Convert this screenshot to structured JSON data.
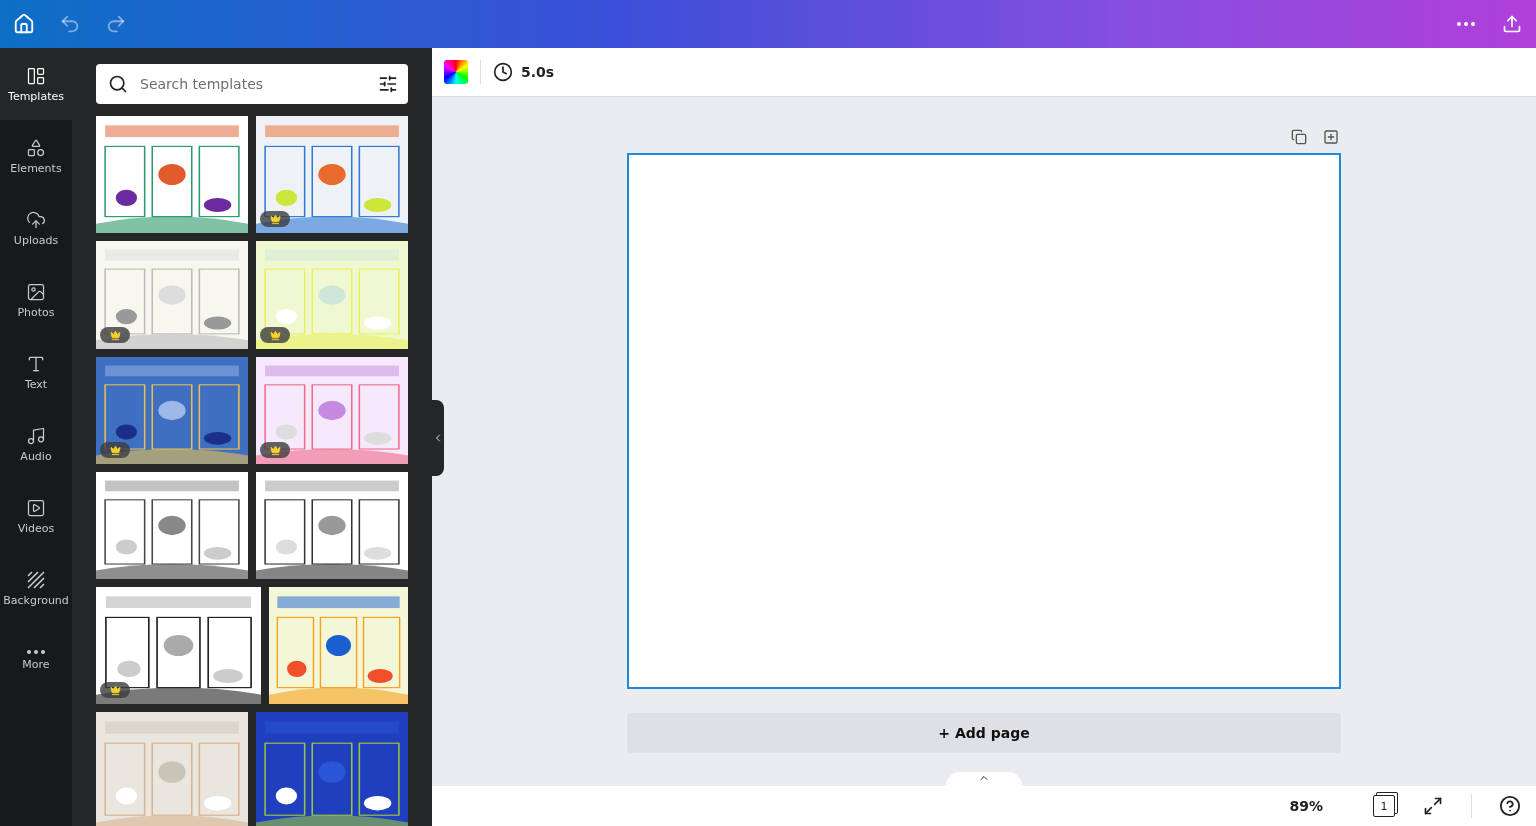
{
  "rail": [
    {
      "label": "Templates",
      "selected": true
    },
    {
      "label": "Elements",
      "selected": false
    },
    {
      "label": "Uploads",
      "selected": false
    },
    {
      "label": "Photos",
      "selected": false
    },
    {
      "label": "Text",
      "selected": false
    },
    {
      "label": "Audio",
      "selected": false
    },
    {
      "label": "Videos",
      "selected": false
    },
    {
      "label": "Background",
      "selected": false
    },
    {
      "label": "More",
      "selected": false
    }
  ],
  "search": {
    "placeholder": "Search templates"
  },
  "templates": [
    {
      "kind": "picture",
      "premium": false
    },
    {
      "kind": "picture",
      "premium": true
    },
    {
      "kind": "picture",
      "premium": true
    },
    {
      "kind": "picture",
      "premium": true
    },
    {
      "kind": "picture",
      "premium": true
    },
    {
      "kind": "picture",
      "premium": true
    },
    {
      "kind": "picture",
      "premium": false
    },
    {
      "kind": "picture",
      "premium": false
    },
    {
      "kind": "picture",
      "premium": true
    },
    {
      "kind": "picture",
      "premium": false
    },
    {
      "kind": "picture",
      "premium": false
    },
    {
      "kind": "picture",
      "premium": false
    }
  ],
  "toolbar": {
    "duration": "5.0s"
  },
  "canvas": {
    "add_page": "+ Add page"
  },
  "status_bar": {
    "zoom": "89%",
    "page_count": "1"
  }
}
